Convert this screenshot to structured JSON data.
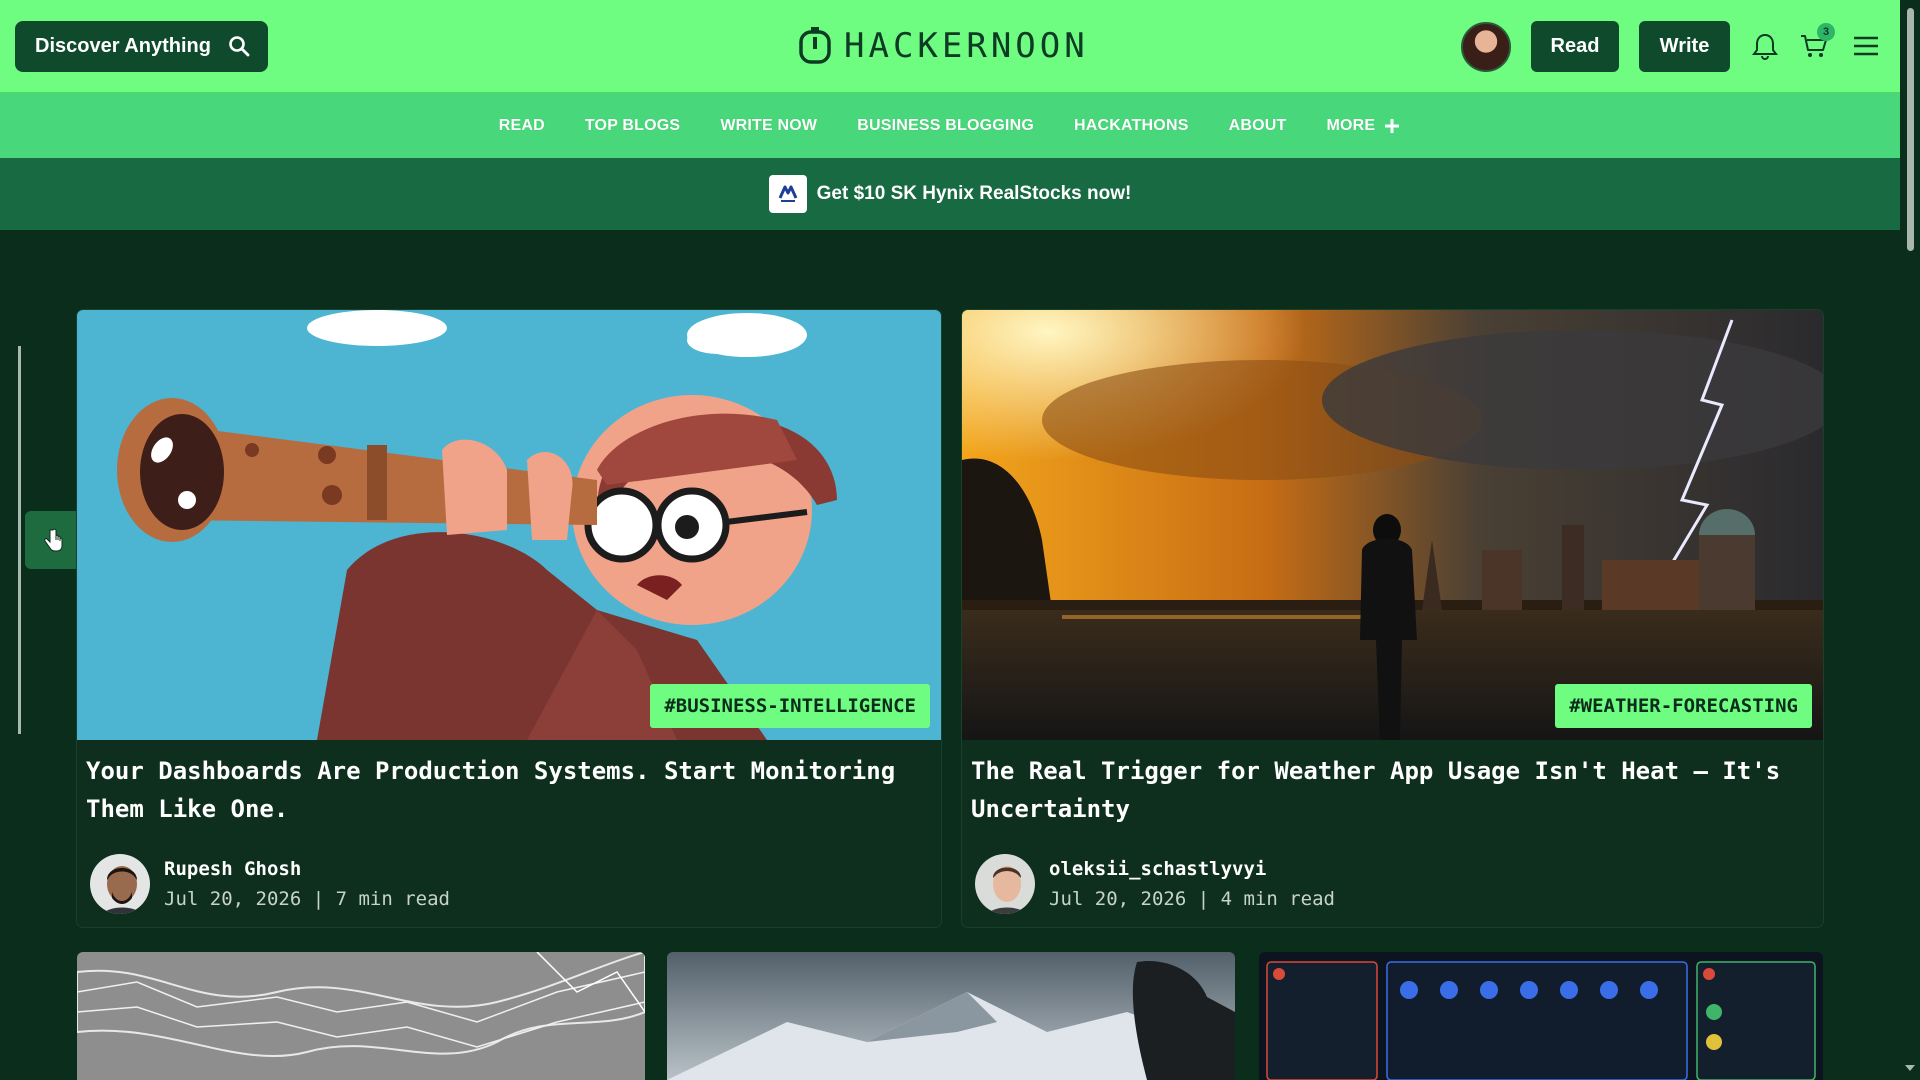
{
  "header": {
    "discover_label": "Discover Anything",
    "logo_text": "HACKERNOON",
    "read_label": "Read",
    "write_label": "Write",
    "cart_count": "3"
  },
  "nav": {
    "items": [
      "READ",
      "TOP BLOGS",
      "WRITE NOW",
      "BUSINESS BLOGGING",
      "HACKATHONS",
      "ABOUT"
    ],
    "more_label": "MORE"
  },
  "promo": {
    "text": "Get $10 SK Hynix RealStocks now!"
  },
  "cards": [
    {
      "tag": "#BUSINESS-INTELLIGENCE",
      "title": "Your Dashboards Are Production Systems. Start Monitoring Them Like One.",
      "author": "Rupesh Ghosh",
      "meta": "Jul 20, 2026 | 7 min read"
    },
    {
      "tag": "#WEATHER-FORECASTING",
      "title": "The Real Trigger for Weather App Usage Isn't Heat – It's Uncertainty",
      "author": "oleksii_schastlyvyi",
      "meta": "Jul 20, 2026 | 4 min read"
    }
  ],
  "colors": {
    "brand_green": "#6efd80",
    "nav_green": "#48d77a",
    "promo_green": "#176a41",
    "background": "#0b2d1c",
    "button_dark": "#0f4a2c"
  }
}
